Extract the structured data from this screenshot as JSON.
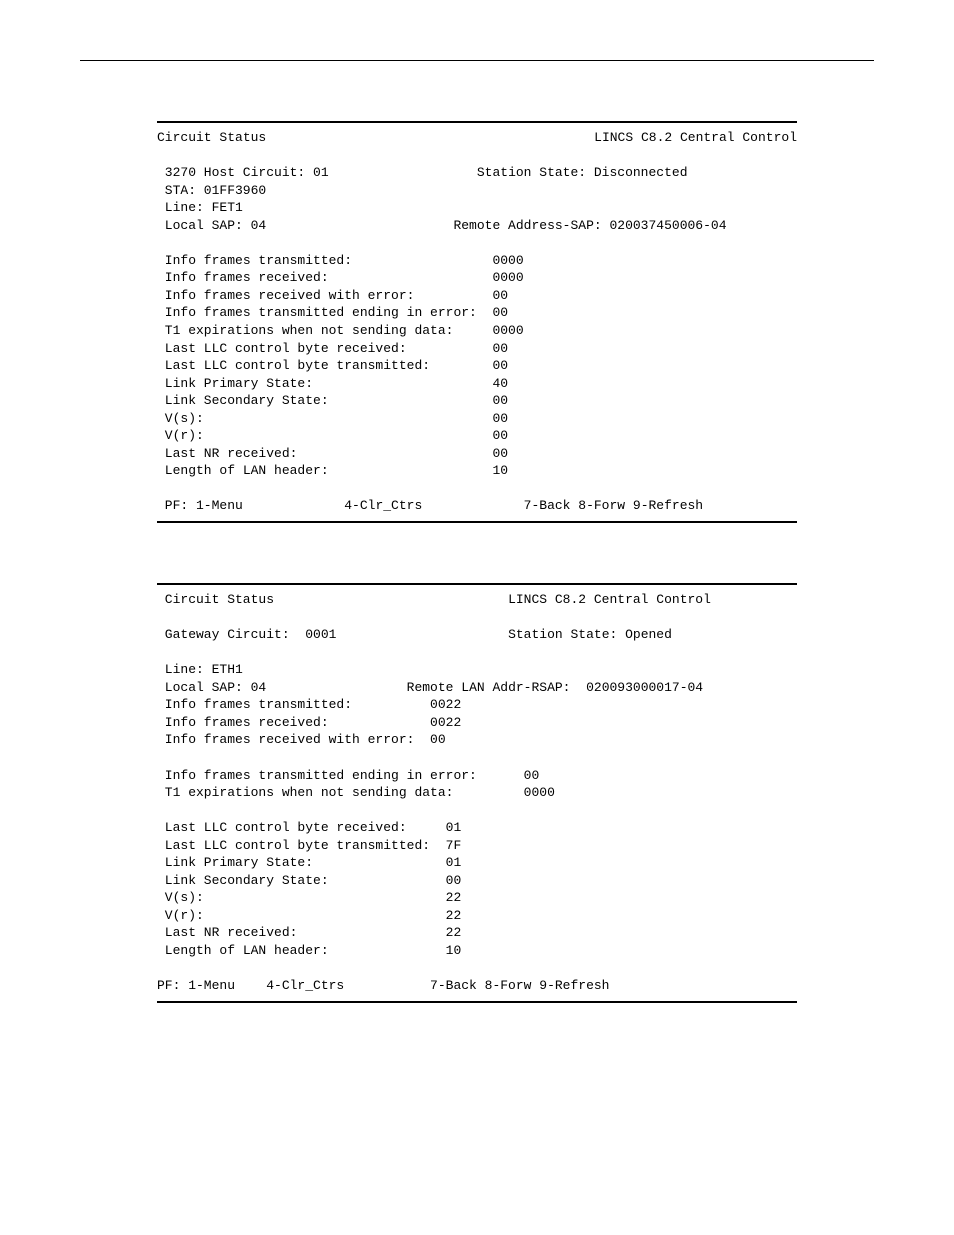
{
  "panel1": {
    "title_left": "Circuit Status",
    "title_right": "LINCS C8.2 Central Control",
    "host_circuit_label": "3270 Host Circuit: 01",
    "station_state_label": "Station State: Disconnected",
    "sta": "STA: 01FF3960",
    "line": "Line: FET1",
    "local_sap": "Local SAP: 04",
    "remote_addr": "Remote Address-SAP: 020037450006-04",
    "stats": [
      {
        "label": "Info frames transmitted:",
        "value": "0000"
      },
      {
        "label": "Info frames received:",
        "value": "0000"
      },
      {
        "label": "Info frames received with error:",
        "value": "00"
      },
      {
        "label": "Info frames transmitted ending in error:",
        "value": "00"
      },
      {
        "label": "T1 expirations when not sending data:",
        "value": "0000"
      },
      {
        "label": "Last LLC control byte received:",
        "value": "00"
      },
      {
        "label": "Last LLC control byte transmitted:",
        "value": "00"
      },
      {
        "label": "Link Primary State:",
        "value": "40"
      },
      {
        "label": "Link Secondary State:",
        "value": "00"
      },
      {
        "label": "V(s):",
        "value": "00"
      },
      {
        "label": "V(r):",
        "value": "00"
      },
      {
        "label": "Last NR received:",
        "value": "00"
      },
      {
        "label": "Length of LAN header:",
        "value": "10"
      }
    ],
    "pf_left": "PF: 1-Menu",
    "pf_mid": "4-Clr_Ctrs",
    "pf_right": "7-Back 8-Forw 9-Refresh"
  },
  "panel2": {
    "title_left": "Circuit Status",
    "title_right": "LINCS C8.2 Central Control",
    "gateway_circuit": "Gateway Circuit:  0001",
    "station_state_label": "Station State: Opened",
    "line": "Line: ETH1",
    "local_sap": "Local SAP: 04",
    "remote_addr": "Remote LAN Addr-RSAP:  020093000017-04",
    "stats_block1": [
      {
        "label": "Info frames transmitted:",
        "value": "0022"
      },
      {
        "label": "Info frames received:",
        "value": "0022"
      },
      {
        "label": "Info frames received with error:",
        "value": "00"
      }
    ],
    "stats_block2": [
      {
        "label": "Info frames transmitted ending in error:",
        "value": "00"
      },
      {
        "label": "T1 expirations when not sending data:",
        "value": "0000"
      }
    ],
    "stats_block3": [
      {
        "label": "Last LLC control byte received:",
        "value": "01"
      },
      {
        "label": "Last LLC control byte transmitted:",
        "value": "7F"
      },
      {
        "label": "Link Primary State:",
        "value": "01"
      },
      {
        "label": "Link Secondary State:",
        "value": "00"
      },
      {
        "label": "V(s):",
        "value": "22"
      },
      {
        "label": "V(r):",
        "value": "22"
      },
      {
        "label": "Last NR received:",
        "value": "22"
      },
      {
        "label": "Length of LAN header:",
        "value": "10"
      }
    ],
    "pf_line": "PF: 1-Menu    4-Clr_Ctrs           7-Back 8-Forw 9-Refresh"
  }
}
